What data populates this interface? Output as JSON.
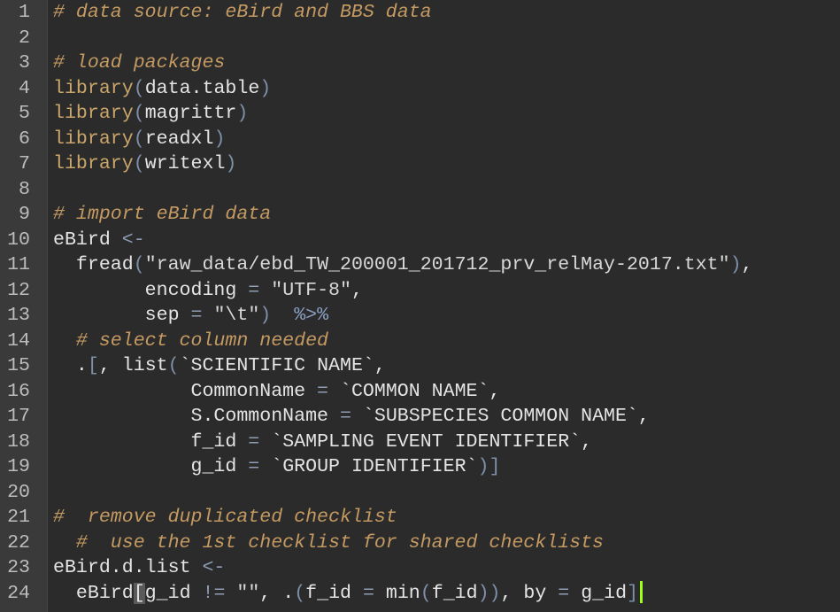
{
  "editor": {
    "lines": [
      {
        "n": "1",
        "tokens": [
          {
            "t": "cm",
            "v": "# data source: eBird and BBS data"
          }
        ]
      },
      {
        "n": "2",
        "tokens": []
      },
      {
        "n": "3",
        "tokens": [
          {
            "t": "cm",
            "v": "# load packages"
          }
        ]
      },
      {
        "n": "4",
        "tokens": [
          {
            "t": "fn",
            "v": "library"
          },
          {
            "t": "br",
            "v": "("
          },
          {
            "t": "tx",
            "v": "data.table"
          },
          {
            "t": "br",
            "v": ")"
          }
        ]
      },
      {
        "n": "5",
        "tokens": [
          {
            "t": "fn",
            "v": "library"
          },
          {
            "t": "br",
            "v": "("
          },
          {
            "t": "tx",
            "v": "magrittr"
          },
          {
            "t": "br",
            "v": ")"
          }
        ]
      },
      {
        "n": "6",
        "tokens": [
          {
            "t": "fn",
            "v": "library"
          },
          {
            "t": "br",
            "v": "("
          },
          {
            "t": "tx",
            "v": "readxl"
          },
          {
            "t": "br",
            "v": ")"
          }
        ]
      },
      {
        "n": "7",
        "tokens": [
          {
            "t": "fn",
            "v": "library"
          },
          {
            "t": "br",
            "v": "("
          },
          {
            "t": "tx",
            "v": "writexl"
          },
          {
            "t": "br",
            "v": ")"
          }
        ]
      },
      {
        "n": "8",
        "tokens": []
      },
      {
        "n": "9",
        "tokens": [
          {
            "t": "cm",
            "v": "# import eBird data"
          }
        ]
      },
      {
        "n": "10",
        "tokens": [
          {
            "t": "tx",
            "v": "eBird "
          },
          {
            "t": "op",
            "v": "<-"
          }
        ]
      },
      {
        "n": "11",
        "tokens": [
          {
            "t": "tx",
            "v": "  fread"
          },
          {
            "t": "br",
            "v": "("
          },
          {
            "t": "st",
            "v": "\"raw_data/ebd_TW_200001_201712_prv_relMay-2017.txt\""
          },
          {
            "t": "br",
            "v": ")"
          },
          {
            "t": "tx",
            "v": ","
          }
        ]
      },
      {
        "n": "12",
        "tokens": [
          {
            "t": "tx",
            "v": "        encoding "
          },
          {
            "t": "op",
            "v": "="
          },
          {
            "t": "tx",
            "v": " "
          },
          {
            "t": "st",
            "v": "\"UTF-8\""
          },
          {
            "t": "tx",
            "v": ","
          }
        ]
      },
      {
        "n": "13",
        "tokens": [
          {
            "t": "tx",
            "v": "        sep "
          },
          {
            "t": "op",
            "v": "="
          },
          {
            "t": "tx",
            "v": " "
          },
          {
            "t": "st",
            "v": "\"\\t\""
          },
          {
            "t": "br",
            "v": ")"
          },
          {
            "t": "tx",
            "v": "  "
          },
          {
            "t": "pipe",
            "v": "%>%"
          }
        ]
      },
      {
        "n": "14",
        "tokens": [
          {
            "t": "cm",
            "v": "  # select column needed"
          }
        ]
      },
      {
        "n": "15",
        "tokens": [
          {
            "t": "tx",
            "v": "  ."
          },
          {
            "t": "br",
            "v": "["
          },
          {
            "t": "tx",
            "v": ", list"
          },
          {
            "t": "br",
            "v": "("
          },
          {
            "t": "bt",
            "v": "`SCIENTIFIC NAME`"
          },
          {
            "t": "tx",
            "v": ","
          }
        ]
      },
      {
        "n": "16",
        "tokens": [
          {
            "t": "tx",
            "v": "            CommonName "
          },
          {
            "t": "op",
            "v": "="
          },
          {
            "t": "tx",
            "v": " "
          },
          {
            "t": "bt",
            "v": "`COMMON NAME`"
          },
          {
            "t": "tx",
            "v": ","
          }
        ]
      },
      {
        "n": "17",
        "tokens": [
          {
            "t": "tx",
            "v": "            S.CommonName "
          },
          {
            "t": "op",
            "v": "="
          },
          {
            "t": "tx",
            "v": " "
          },
          {
            "t": "bt",
            "v": "`SUBSPECIES COMMON NAME`"
          },
          {
            "t": "tx",
            "v": ","
          }
        ]
      },
      {
        "n": "18",
        "tokens": [
          {
            "t": "tx",
            "v": "            f_id "
          },
          {
            "t": "op",
            "v": "="
          },
          {
            "t": "tx",
            "v": " "
          },
          {
            "t": "bt",
            "v": "`SAMPLING EVENT IDENTIFIER`"
          },
          {
            "t": "tx",
            "v": ","
          }
        ]
      },
      {
        "n": "19",
        "tokens": [
          {
            "t": "tx",
            "v": "            g_id "
          },
          {
            "t": "op",
            "v": "="
          },
          {
            "t": "tx",
            "v": " "
          },
          {
            "t": "bt",
            "v": "`GROUP IDENTIFIER`"
          },
          {
            "t": "br",
            "v": ")]"
          }
        ]
      },
      {
        "n": "20",
        "tokens": []
      },
      {
        "n": "21",
        "tokens": [
          {
            "t": "cm",
            "v": "#  remove duplicated checklist"
          }
        ]
      },
      {
        "n": "22",
        "tokens": [
          {
            "t": "cm",
            "v": "  #  use the 1st checklist for shared checklists"
          }
        ]
      },
      {
        "n": "23",
        "tokens": [
          {
            "t": "tx",
            "v": "eBird.d.list "
          },
          {
            "t": "op",
            "v": "<-"
          }
        ]
      },
      {
        "n": "24",
        "tokens": [
          {
            "t": "tx",
            "v": "  eBird"
          },
          {
            "t": "mt",
            "v": "["
          },
          {
            "t": "tx",
            "v": "g_id "
          },
          {
            "t": "op",
            "v": "!="
          },
          {
            "t": "tx",
            "v": " "
          },
          {
            "t": "st",
            "v": "\"\""
          },
          {
            "t": "tx",
            "v": ", ."
          },
          {
            "t": "br",
            "v": "("
          },
          {
            "t": "tx",
            "v": "f_id "
          },
          {
            "t": "op",
            "v": "="
          },
          {
            "t": "tx",
            "v": " min"
          },
          {
            "t": "br",
            "v": "("
          },
          {
            "t": "tx",
            "v": "f_id"
          },
          {
            "t": "br",
            "v": "))"
          },
          {
            "t": "tx",
            "v": ", by "
          },
          {
            "t": "op",
            "v": "="
          },
          {
            "t": "tx",
            "v": " g_id"
          },
          {
            "t": "br",
            "v": "]"
          }
        ]
      }
    ],
    "colors": {
      "background": "#2b2b2b",
      "gutter": "#3a3a3a",
      "comment": "#c49a62",
      "function": "#cba66a",
      "bracket": "#7e8fa8",
      "cursor": "#9cff1a"
    }
  }
}
